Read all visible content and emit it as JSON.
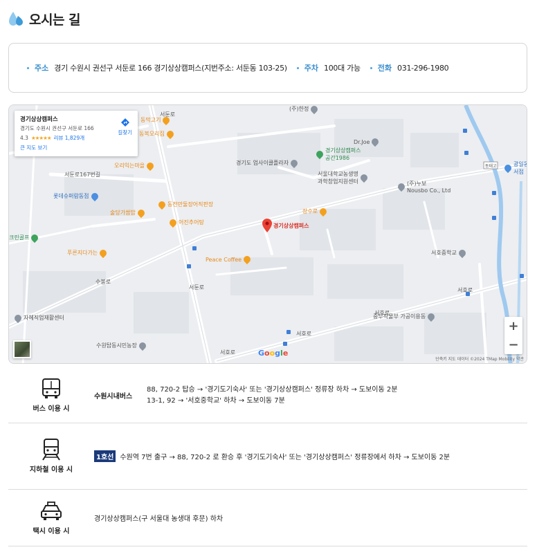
{
  "header": {
    "title": "오시는 길",
    "icon": "drop-icon"
  },
  "info": {
    "address_label": "주소",
    "address_value": "경기 수원시 권선구 서둔로 166 경기상상캠퍼스(지번주소: 서둔동 103-25)",
    "parking_label": "주차",
    "parking_value": "100대 가능",
    "phone_label": "전화",
    "phone_value": "031-296-1980",
    "accent_color": "#3a8fd0"
  },
  "map": {
    "place_card": {
      "name": "경기상상캠퍼스",
      "address": "경기도 수원시 권선구 서둔로 166",
      "rating": "4.3",
      "stars": "★★★★★",
      "reviews": "리뷰 1,829개",
      "bigger_map": "큰 지도 보기",
      "directions": "길찾기"
    },
    "marker_label": "경기상상캠퍼스",
    "pois": {
      "p1": "(주)한정",
      "p2": "동막고기",
      "p3": "동복오리집",
      "p4": "Dr.Joe",
      "p5": "경기상상캠퍼스\n공간1986",
      "p6": "경기도 업사이클플라자",
      "p7": "서울대학교농생명\n과학창업지원센터",
      "p8": "(주)누보\nNousbo Co., Ltd",
      "p9": "오리익는마을",
      "p10": "롯데슈퍼람동점",
      "p11": "동천만둘장어직판장",
      "p12": "술당가쌈밥",
      "p13": "어진추어탕",
      "p14": "장수로",
      "p15": "서호중학교",
      "p16": "푸른지다가는",
      "p17": "Peace Coffee",
      "p18": "자혜직업재활센터",
      "p19": "중부작물부 가공이용동",
      "p20": "수원탑동시민농장",
      "p21": "크린골프",
      "p22": "광일동\n서점",
      "p23": "동태고"
    },
    "roads": {
      "r1": "서둔로",
      "r2": "서둔로167번길",
      "r3": "수봉로",
      "r4": "서호로",
      "r5": "서호로",
      "r6": "서둔로",
      "r7": "서호로",
      "r8": "서호로"
    },
    "google": "Google",
    "footer": "단축키   지도 데이터 ©2024 TMap Mobility   약관",
    "zoom_in": "+",
    "zoom_out": "−"
  },
  "transport": {
    "bus": {
      "label": "버스 이용 시",
      "sub": "수원시내버스",
      "line1": "88, 720-2 탑승 → '경기도기숙사' 또는 '경기상상캠퍼스' 정류장 하차 → 도보이동 2분",
      "line2": "13-1, 92 → '서호중학교' 하차 → 도보이동 7분"
    },
    "subway": {
      "label": "지하철 이용 시",
      "badge": "1호선",
      "text": "수원역 7번 출구 → 88, 720-2 로 환승 후 '경기도기숙사' 또는 '경기상상캠퍼스' 정류장에서 하차 → 도보이동 2분",
      "badge_color": "#1b3a7a"
    },
    "taxi": {
      "label": "택시 이용 시",
      "text": "경기상상캠퍼스(구 서울대 농생대 후문) 하차"
    }
  }
}
